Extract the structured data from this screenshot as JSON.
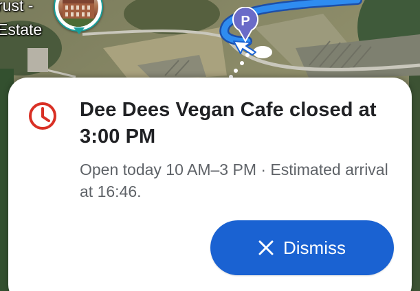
{
  "map": {
    "label_line1": "rust -",
    "label_line2": "Estate",
    "parking_glyph": "P",
    "icons": [
      "place-photo-pin",
      "parking-icon",
      "navigation-arrow"
    ]
  },
  "alert": {
    "icon": "clock-icon",
    "icon_color": "#d93025",
    "title": "Dee Dees Vegan Cafe closed at 3:00 PM",
    "detail": "Open today 10 AM–3 PM · Estimated arrival at 16:46.",
    "dismiss_label": "Dismiss",
    "dismiss_icon": "close-icon",
    "button_color": "#1a62d2"
  }
}
